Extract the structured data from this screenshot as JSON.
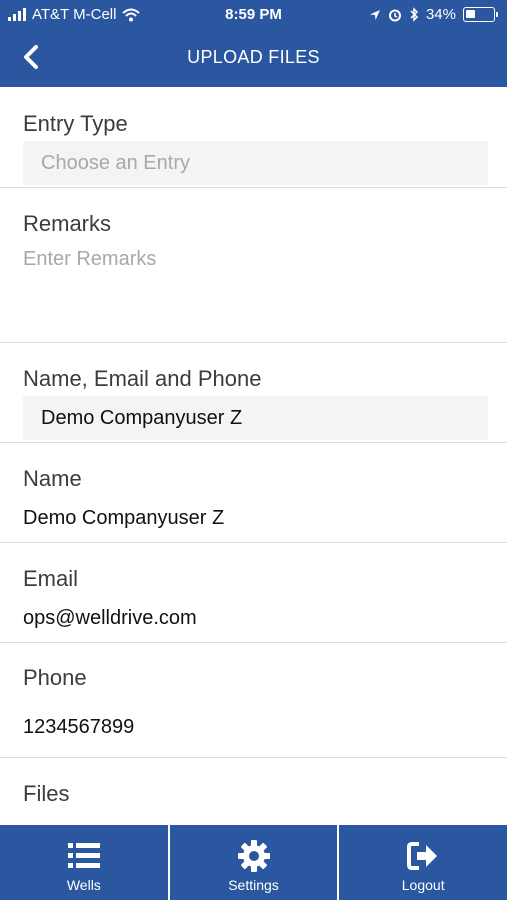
{
  "status_bar": {
    "carrier": "AT&T M-Cell",
    "time": "8:59 PM",
    "battery_percent": "34%",
    "battery_level": 0.34
  },
  "header": {
    "back_icon": "chevron-left-icon",
    "title": "UPLOAD FILES"
  },
  "form": {
    "entry_type": {
      "label": "Entry Type",
      "placeholder": "Choose an Entry"
    },
    "remarks": {
      "label": "Remarks",
      "placeholder": "Enter Remarks"
    },
    "contact": {
      "label": "Name, Email and Phone",
      "value": "Demo Companyuser Z"
    },
    "name": {
      "label": "Name",
      "value": "Demo Companyuser Z"
    },
    "email": {
      "label": "Email",
      "value": "ops@welldrive.com"
    },
    "phone": {
      "label": "Phone",
      "value": "1234567899"
    },
    "files": {
      "label": "Files"
    }
  },
  "tabbar": {
    "items": [
      {
        "label": "Wells",
        "icon": "list-icon"
      },
      {
        "label": "Settings",
        "icon": "gear-icon"
      },
      {
        "label": "Logout",
        "icon": "logout-icon"
      }
    ]
  },
  "colors": {
    "brand": "#2b56a0",
    "divider": "#dcdcdc",
    "field_bg": "#f4f4f4",
    "placeholder": "#a8a8a8"
  }
}
